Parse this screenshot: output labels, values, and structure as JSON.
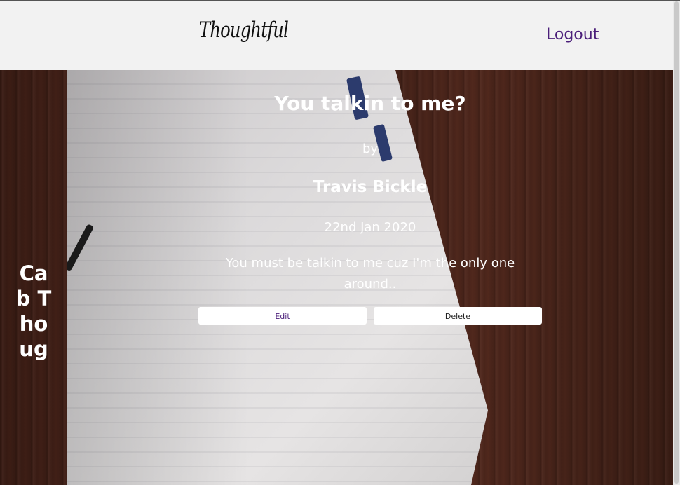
{
  "navbar": {
    "brand": "Thoughtful",
    "logout_label": "Logout"
  },
  "sidebar": {
    "title": "Cab Thoug"
  },
  "post": {
    "title": "You talkin to me?",
    "by_label": "by",
    "author": "Travis Bickle",
    "date": "22nd Jan 2020",
    "body": "You must be talkin to me cuz I'm the only one around.."
  },
  "actions": {
    "edit_label": "Edit",
    "delete_label": "Delete"
  },
  "colors": {
    "navbar_bg": "#f2f2f2",
    "link_accent": "#4b1f7a",
    "wood_bg": "#3a1c14",
    "text_on_photo": "#ffffff"
  }
}
